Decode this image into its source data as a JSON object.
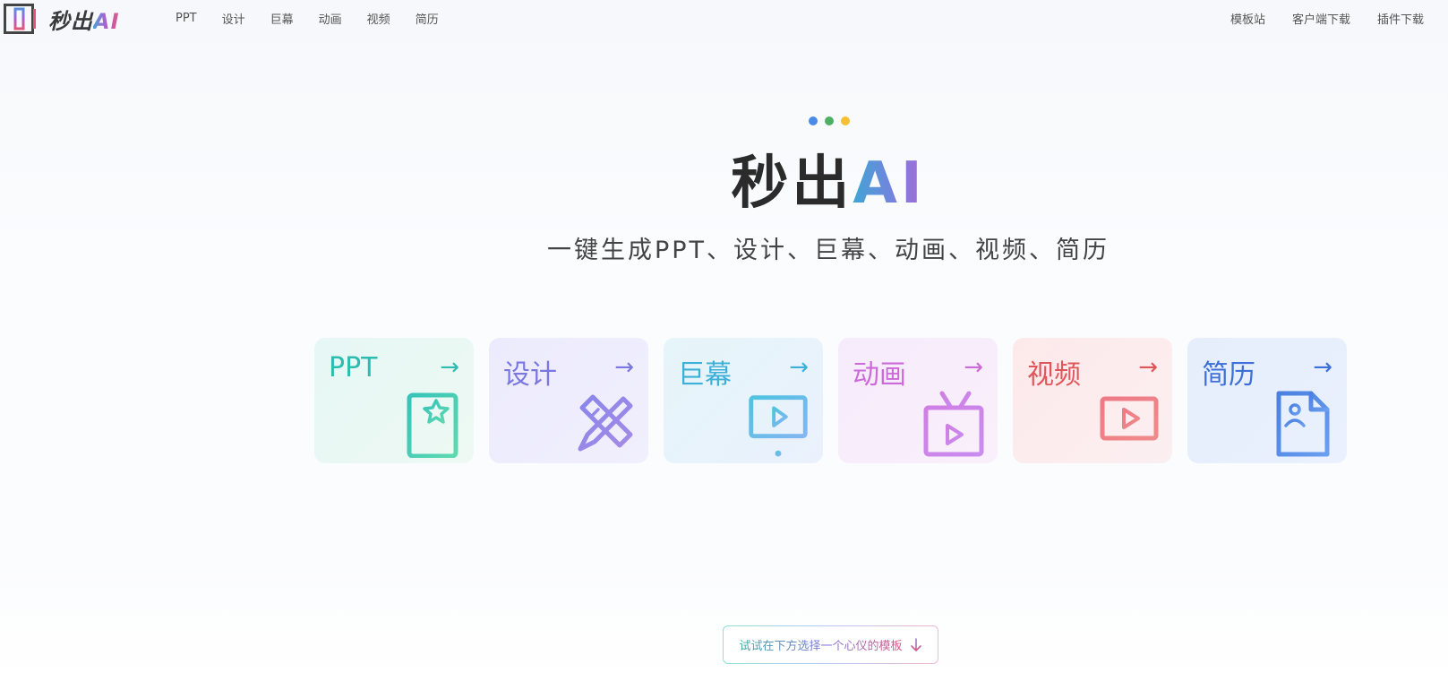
{
  "header": {
    "logo": {
      "text": "秒出",
      "ai": "AI"
    },
    "nav_left": [
      "PPT",
      "设计",
      "巨幕",
      "动画",
      "视频",
      "简历"
    ],
    "nav_right": [
      "模板站",
      "客户端下载",
      "插件下载"
    ]
  },
  "hero": {
    "dots": [
      "#4b8be8",
      "#4cb062",
      "#f5c034"
    ],
    "title": "秒出",
    "title_ai": "AI",
    "subtitle": "一键生成PPT、设计、巨幕、动画、视频、简历"
  },
  "cards": [
    {
      "label": "PPT",
      "arrow": "→",
      "icon": "ppt-document-star-icon",
      "color": "#2cbcb0",
      "bg": [
        "#e6f7f5",
        "#eef9f3"
      ]
    },
    {
      "label": "设计",
      "arrow": "→",
      "icon": "pencil-ruler-icon",
      "color": "#7a77e0",
      "bg": [
        "#ecebfd",
        "#f1effd"
      ]
    },
    {
      "label": "巨幕",
      "arrow": "→",
      "icon": "projector-screen-icon",
      "color": "#3cb0d8",
      "bg": [
        "#e5f5fa",
        "#eaf1fc"
      ]
    },
    {
      "label": "动画",
      "arrow": "→",
      "icon": "tv-play-icon",
      "color": "#cb6ad8",
      "bg": [
        "#f6ebfb",
        "#faf0fb"
      ]
    },
    {
      "label": "视频",
      "arrow": "→",
      "icon": "laptop-play-icon",
      "color": "#e0555a",
      "bg": [
        "#fde9ea",
        "#fbeff1"
      ]
    },
    {
      "label": "简历",
      "arrow": "→",
      "icon": "resume-profile-icon",
      "color": "#3d6fd8",
      "bg": [
        "#e6eefc",
        "#eaf0fd"
      ]
    }
  ],
  "hint": {
    "text": "试试在下方选择一个心仪的模板",
    "icon": "arrow-down-icon"
  }
}
